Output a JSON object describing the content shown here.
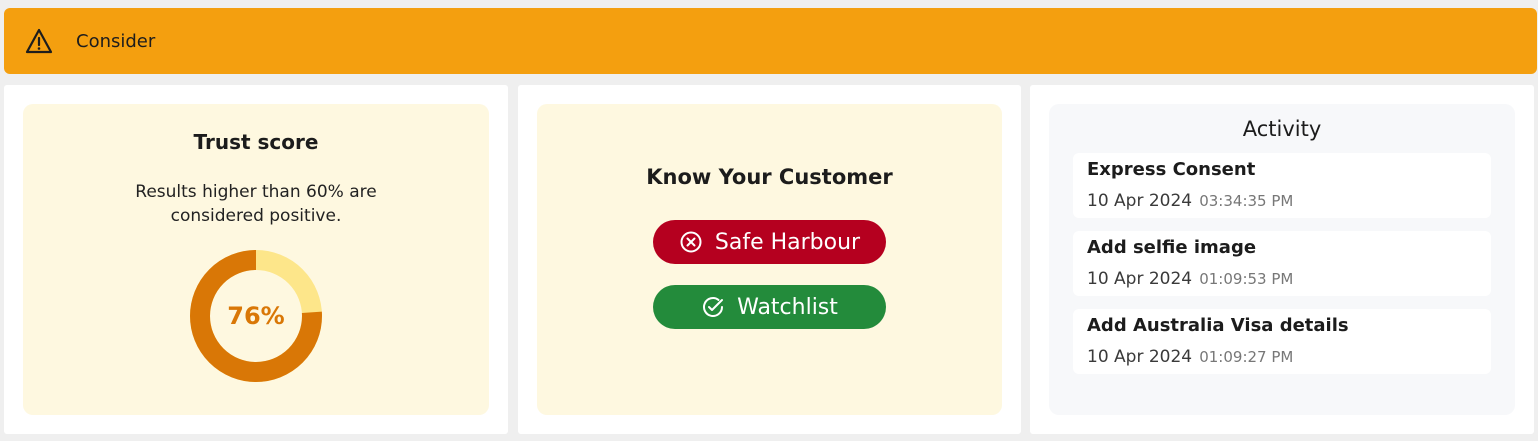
{
  "banner": {
    "icon": "warning-triangle-icon",
    "title": "Consider",
    "color": "#f49f0f"
  },
  "trust_score": {
    "title": "Trust score",
    "description": "Results higher than 60% are considered positive.",
    "value_label": "76%",
    "value": 0.76,
    "colors": {
      "filled": "#d97706",
      "remaining": "#fde68a"
    }
  },
  "kyc": {
    "title": "Know Your Customer",
    "checks": [
      {
        "label": "Safe Harbour",
        "status": "failed",
        "icon": "x-circle-icon",
        "color": "#b5001f"
      },
      {
        "label": "Watchlist",
        "status": "passed",
        "icon": "check-circle-icon",
        "color": "#238b3b"
      }
    ]
  },
  "activity": {
    "title": "Activity",
    "items": [
      {
        "name": "Express Consent",
        "date": "10 Apr 2024",
        "time": "03:34:35 PM"
      },
      {
        "name": "Add selfie image",
        "date": "10 Apr 2024",
        "time": "01:09:53 PM"
      },
      {
        "name": "Add Australia Visa details",
        "date": "10 Apr 2024",
        "time": "01:09:27 PM"
      }
    ]
  }
}
